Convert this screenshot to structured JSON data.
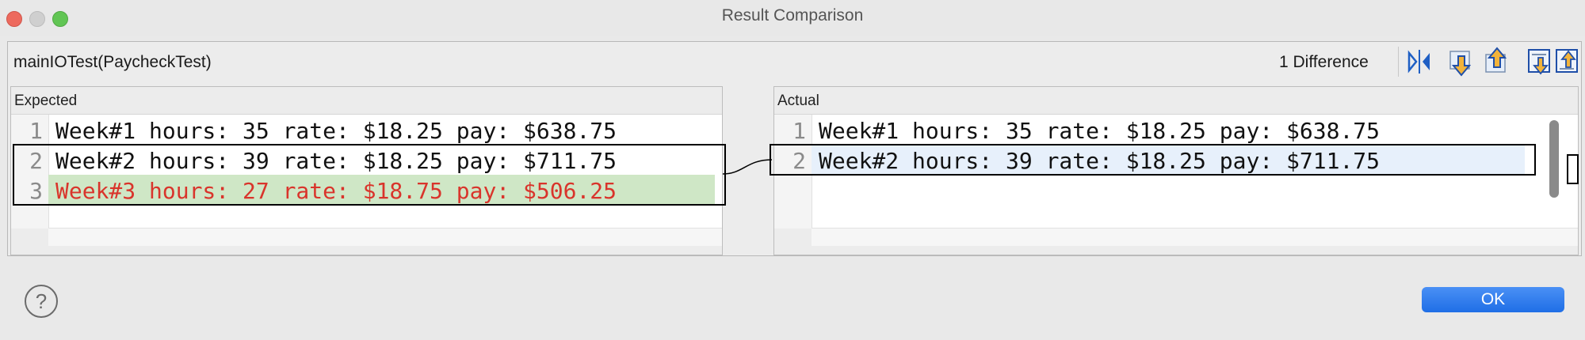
{
  "window": {
    "title": "Result Comparison"
  },
  "header": {
    "test_name": "mainIOTest(PaycheckTest)",
    "diff_count": "1 Difference"
  },
  "toolbar": {
    "buttons": [
      {
        "icon": "split-view-icon",
        "color": "#1f5fc4"
      },
      {
        "icon": "next-difference-icon",
        "color": "#e0a020"
      },
      {
        "icon": "previous-difference-icon",
        "color": "#e0a020"
      },
      {
        "icon": "next-change-icon",
        "color": "#e0a020"
      },
      {
        "icon": "previous-change-icon",
        "color": "#e0a020"
      }
    ]
  },
  "expected": {
    "label": "Expected",
    "lines": [
      {
        "num": "1",
        "text": "Week#1 hours: 35 rate: $18.25 pay: $638.75"
      },
      {
        "num": "2",
        "text": "Week#2 hours: 39 rate: $18.25 pay: $711.75"
      },
      {
        "num": "3",
        "text": "Week#3 hours: 27 rate: $18.75 pay: $506.25"
      }
    ]
  },
  "actual": {
    "label": "Actual",
    "lines": [
      {
        "num": "1",
        "text": "Week#1 hours: 35 rate: $18.25 pay: $638.75"
      },
      {
        "num": "2",
        "text": "Week#2 hours: 39 rate: $18.25 pay: $711.75"
      }
    ]
  },
  "footer": {
    "help_symbol": "?",
    "ok_label": "OK"
  },
  "colors": {
    "added_text": "#d9342b",
    "added_bg": "#cfe7c6",
    "selected_bg": "#e7f0fb",
    "ok_button": "#2a7af0"
  }
}
